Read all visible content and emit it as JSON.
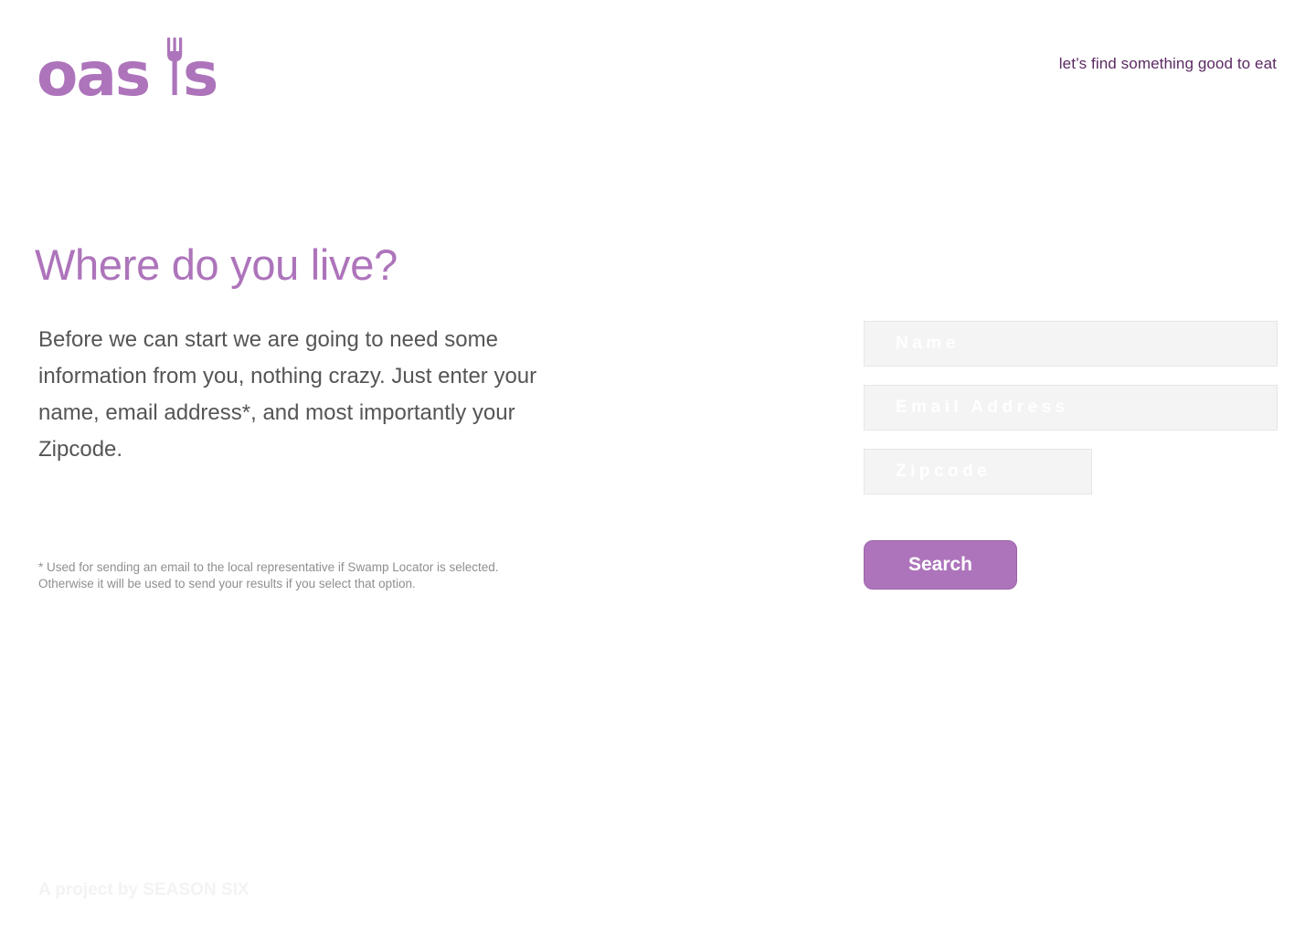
{
  "brand": {
    "logo_text": "oasis",
    "tagline": "let’s find something good to eat",
    "accent_color": "#ad74bb",
    "tagline_color": "#5c2a63"
  },
  "main": {
    "heading": "Where do you live?",
    "intro": "Before we can start we are going to need some information from you, nothing crazy. Just enter your name, email address*, and most importantly your Zipcode.",
    "footnote_line1": "* Used for sending an email to the local representative if Swamp Locator is selected.",
    "footnote_line2": "Otherwise it will be used to send your results if you select that option."
  },
  "form": {
    "name_placeholder": "Name",
    "email_placeholder": "Email Address",
    "zip_placeholder": "Zipcode",
    "search_label": "Search"
  },
  "footer": {
    "credit": "A project by SEASON SIX"
  }
}
